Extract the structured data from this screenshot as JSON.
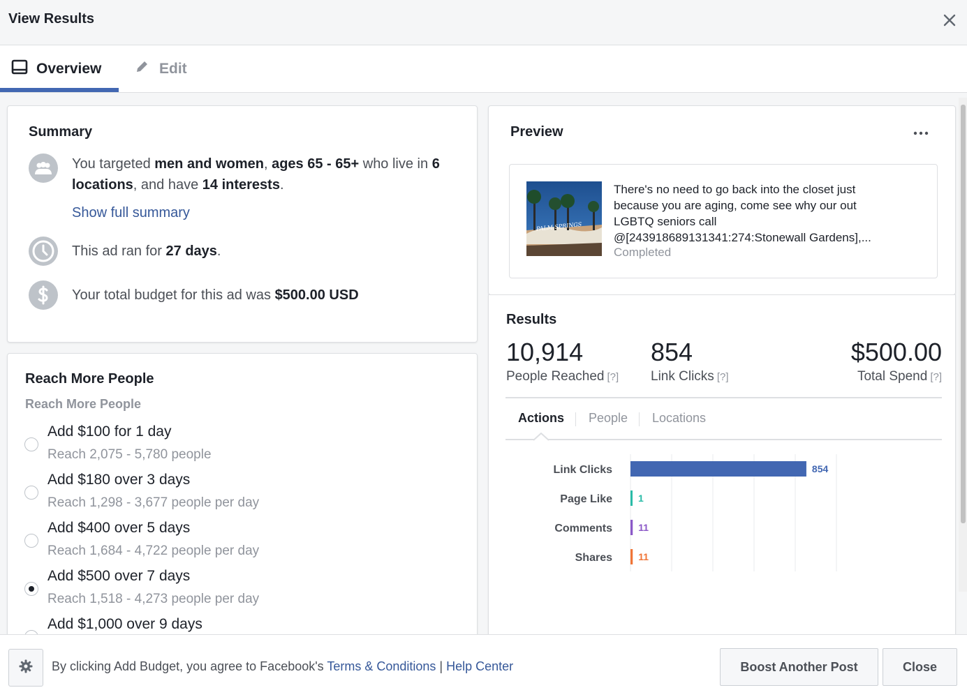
{
  "header": {
    "title": "View Results",
    "close_icon": "close-icon"
  },
  "tabs": [
    {
      "label": "Overview",
      "icon": "tablet-icon",
      "active": true
    },
    {
      "label": "Edit",
      "icon": "pencil-icon",
      "active": false
    }
  ],
  "summary": {
    "title": "Summary",
    "targeting": {
      "t1": "You targeted ",
      "b1": "men and women",
      "t2": ", ",
      "b2": "ages 65 - 65+",
      "t3": " who live in ",
      "b3": "6 locations",
      "t4": ", and have ",
      "b4": "14 interests",
      "t5": "."
    },
    "show_full": "Show full summary",
    "duration": {
      "t1": "This ad ran for ",
      "b1": "27 days",
      "t2": "."
    },
    "budget": {
      "t1": "Your total budget for this ad was ",
      "b1": "$500.00 USD"
    }
  },
  "reach": {
    "title": "Reach More People",
    "subtitle": "Reach More People",
    "options": [
      {
        "label": "Add $100 for 1 day",
        "detail": "Reach 2,075 - 5,780 people",
        "checked": false
      },
      {
        "label": "Add $180 over 3 days",
        "detail": "Reach 1,298 - 3,677 people per day",
        "checked": false
      },
      {
        "label": "Add $400 over 5 days",
        "detail": "Reach 1,684 - 4,722 people per day",
        "checked": false
      },
      {
        "label": "Add $500 over 7 days",
        "detail": "Reach 1,518 - 4,273 people per day",
        "checked": true
      },
      {
        "label": "Add $1,000 over 9 days",
        "detail": "",
        "checked": false
      }
    ]
  },
  "preview": {
    "title": "Preview",
    "menu_icon": "more-dots-icon",
    "thumb_sign": "PALM SPRINGS",
    "post_lines": [
      "There's no need to go back into the closet just",
      "because you are aging, come see why our out",
      "LGBTQ seniors call",
      "@[243918689131341:274:Stonewall Gardens],..."
    ],
    "status": "Completed"
  },
  "results": {
    "title": "Results",
    "q": "[?]",
    "metrics": [
      {
        "value": "10,914",
        "label": "People Reached"
      },
      {
        "value": "854",
        "label": "Link Clicks"
      },
      {
        "value": "$500.00",
        "label": "Total Spend"
      }
    ],
    "subtabs": [
      "Actions",
      "People",
      "Locations"
    ]
  },
  "chart_data": {
    "type": "bar",
    "orientation": "horizontal",
    "categories": [
      "Link Clicks",
      "Page Like",
      "Comments",
      "Shares"
    ],
    "values": [
      854,
      1,
      11,
      11
    ],
    "colors": [
      "#4267b2",
      "#2abba7",
      "#8c59c8",
      "#f07537"
    ],
    "xlim": [
      0,
      1000
    ],
    "grid": true
  },
  "footer": {
    "t1": "By clicking Add Budget, you agree to Facebook's ",
    "terms": "Terms & Conditions",
    "sep": " | ",
    "help": "Help Center",
    "boost": "Boost Another Post",
    "close": "Close"
  }
}
